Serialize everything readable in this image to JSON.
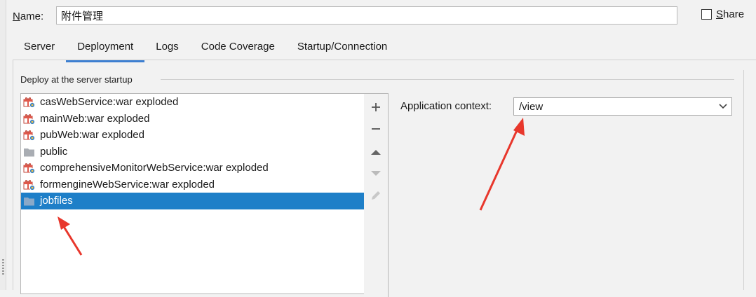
{
  "form": {
    "name_label": "Name:",
    "name_label_mnemonic": "N",
    "name_label_rest": "ame:",
    "name_value": "附件管理",
    "share_mnemonic": "S",
    "share_rest": "hare",
    "share_checked": false
  },
  "tabs": [
    {
      "label": "Server",
      "active": false
    },
    {
      "label": "Deployment",
      "active": true
    },
    {
      "label": "Logs",
      "active": false
    },
    {
      "label": "Code Coverage",
      "active": false
    },
    {
      "label": "Startup/Connection",
      "active": false
    }
  ],
  "deploy": {
    "section_title": "Deploy at the server startup",
    "items": [
      {
        "label": "casWebService:war exploded",
        "icon": "war-artifact-icon",
        "selected": false
      },
      {
        "label": "mainWeb:war exploded",
        "icon": "war-artifact-icon",
        "selected": false
      },
      {
        "label": "pubWeb:war exploded",
        "icon": "war-artifact-icon",
        "selected": false
      },
      {
        "label": "public",
        "icon": "folder-icon",
        "selected": false
      },
      {
        "label": "comprehensiveMonitorWebService:war exploded",
        "icon": "war-artifact-icon",
        "selected": false
      },
      {
        "label": "formengineWebService:war exploded",
        "icon": "war-artifact-icon",
        "selected": false
      },
      {
        "label": "jobfiles",
        "icon": "folder-icon",
        "selected": true
      }
    ],
    "toolbar": [
      "add-icon",
      "remove-icon",
      "move-up-icon",
      "move-down-icon",
      "edit-icon"
    ]
  },
  "context": {
    "label": "Application context:",
    "value": "/view"
  },
  "colors": {
    "selection": "#1e7fc8",
    "tab_accent": "#3d7fd1",
    "annotation_arrow": "#e8372c"
  }
}
